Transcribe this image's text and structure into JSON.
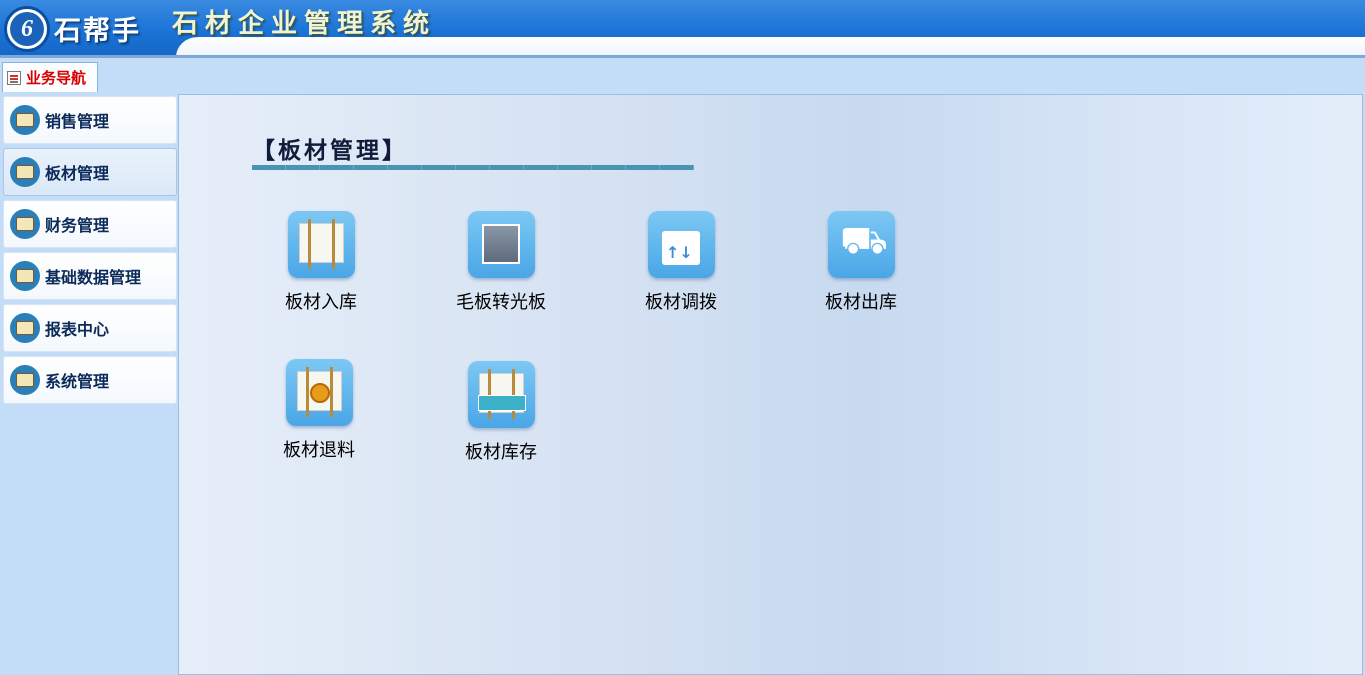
{
  "header": {
    "logo_mark": "6",
    "brand": "石帮手",
    "title": "石材企业管理系统"
  },
  "nav_tab": {
    "label": "业务导航"
  },
  "sidebar": {
    "items": [
      {
        "label": "销售管理",
        "icon": "sales-icon"
      },
      {
        "label": "板材管理",
        "icon": "slab-icon"
      },
      {
        "label": "财务管理",
        "icon": "finance-icon"
      },
      {
        "label": "基础数据管理",
        "icon": "base-data-icon"
      },
      {
        "label": "报表中心",
        "icon": "report-icon"
      },
      {
        "label": "系统管理",
        "icon": "system-icon"
      }
    ],
    "active_index": 1
  },
  "main": {
    "section_title": "【板材管理】",
    "tiles": [
      {
        "label": "板材入库",
        "icon": "slab-inbound-icon"
      },
      {
        "label": "毛板转光板",
        "icon": "rough-to-polished-icon"
      },
      {
        "label": "板材调拨",
        "icon": "slab-transfer-icon"
      },
      {
        "label": "板材出库",
        "icon": "slab-outbound-icon"
      },
      {
        "label": "板材退料",
        "icon": "slab-return-icon"
      },
      {
        "label": "板材库存",
        "icon": "slab-inventory-icon"
      }
    ]
  },
  "colors": {
    "header_blue": "#1a73d6",
    "tab_label_red": "#d80000",
    "sidebar_bg": "#c3dcf8",
    "tile_icon_blue": "#4aa6e6",
    "section_line": "#4b93b3"
  }
}
